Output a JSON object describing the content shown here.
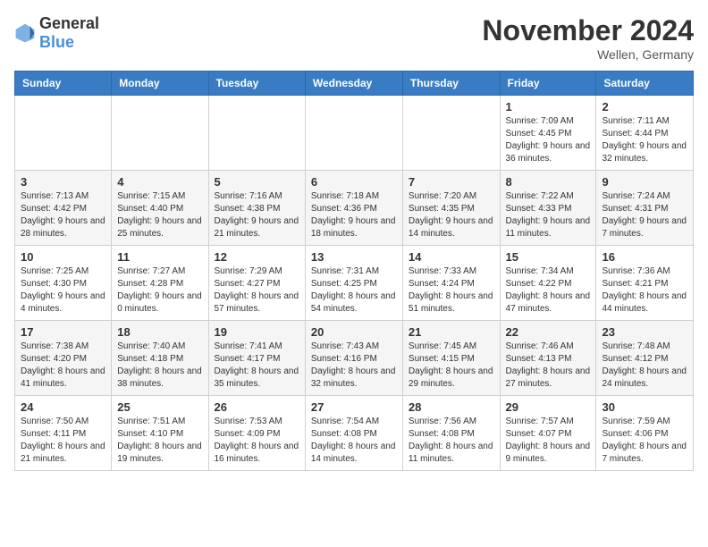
{
  "logo": {
    "general": "General",
    "blue": "Blue"
  },
  "title": "November 2024",
  "location": "Wellen, Germany",
  "weekdays": [
    "Sunday",
    "Monday",
    "Tuesday",
    "Wednesday",
    "Thursday",
    "Friday",
    "Saturday"
  ],
  "weeks": [
    [
      {
        "day": "",
        "sunrise": "",
        "sunset": "",
        "daylight": ""
      },
      {
        "day": "",
        "sunrise": "",
        "sunset": "",
        "daylight": ""
      },
      {
        "day": "",
        "sunrise": "",
        "sunset": "",
        "daylight": ""
      },
      {
        "day": "",
        "sunrise": "",
        "sunset": "",
        "daylight": ""
      },
      {
        "day": "",
        "sunrise": "",
        "sunset": "",
        "daylight": ""
      },
      {
        "day": "1",
        "sunrise": "Sunrise: 7:09 AM",
        "sunset": "Sunset: 4:45 PM",
        "daylight": "Daylight: 9 hours and 36 minutes."
      },
      {
        "day": "2",
        "sunrise": "Sunrise: 7:11 AM",
        "sunset": "Sunset: 4:44 PM",
        "daylight": "Daylight: 9 hours and 32 minutes."
      }
    ],
    [
      {
        "day": "3",
        "sunrise": "Sunrise: 7:13 AM",
        "sunset": "Sunset: 4:42 PM",
        "daylight": "Daylight: 9 hours and 28 minutes."
      },
      {
        "day": "4",
        "sunrise": "Sunrise: 7:15 AM",
        "sunset": "Sunset: 4:40 PM",
        "daylight": "Daylight: 9 hours and 25 minutes."
      },
      {
        "day": "5",
        "sunrise": "Sunrise: 7:16 AM",
        "sunset": "Sunset: 4:38 PM",
        "daylight": "Daylight: 9 hours and 21 minutes."
      },
      {
        "day": "6",
        "sunrise": "Sunrise: 7:18 AM",
        "sunset": "Sunset: 4:36 PM",
        "daylight": "Daylight: 9 hours and 18 minutes."
      },
      {
        "day": "7",
        "sunrise": "Sunrise: 7:20 AM",
        "sunset": "Sunset: 4:35 PM",
        "daylight": "Daylight: 9 hours and 14 minutes."
      },
      {
        "day": "8",
        "sunrise": "Sunrise: 7:22 AM",
        "sunset": "Sunset: 4:33 PM",
        "daylight": "Daylight: 9 hours and 11 minutes."
      },
      {
        "day": "9",
        "sunrise": "Sunrise: 7:24 AM",
        "sunset": "Sunset: 4:31 PM",
        "daylight": "Daylight: 9 hours and 7 minutes."
      }
    ],
    [
      {
        "day": "10",
        "sunrise": "Sunrise: 7:25 AM",
        "sunset": "Sunset: 4:30 PM",
        "daylight": "Daylight: 9 hours and 4 minutes."
      },
      {
        "day": "11",
        "sunrise": "Sunrise: 7:27 AM",
        "sunset": "Sunset: 4:28 PM",
        "daylight": "Daylight: 9 hours and 0 minutes."
      },
      {
        "day": "12",
        "sunrise": "Sunrise: 7:29 AM",
        "sunset": "Sunset: 4:27 PM",
        "daylight": "Daylight: 8 hours and 57 minutes."
      },
      {
        "day": "13",
        "sunrise": "Sunrise: 7:31 AM",
        "sunset": "Sunset: 4:25 PM",
        "daylight": "Daylight: 8 hours and 54 minutes."
      },
      {
        "day": "14",
        "sunrise": "Sunrise: 7:33 AM",
        "sunset": "Sunset: 4:24 PM",
        "daylight": "Daylight: 8 hours and 51 minutes."
      },
      {
        "day": "15",
        "sunrise": "Sunrise: 7:34 AM",
        "sunset": "Sunset: 4:22 PM",
        "daylight": "Daylight: 8 hours and 47 minutes."
      },
      {
        "day": "16",
        "sunrise": "Sunrise: 7:36 AM",
        "sunset": "Sunset: 4:21 PM",
        "daylight": "Daylight: 8 hours and 44 minutes."
      }
    ],
    [
      {
        "day": "17",
        "sunrise": "Sunrise: 7:38 AM",
        "sunset": "Sunset: 4:20 PM",
        "daylight": "Daylight: 8 hours and 41 minutes."
      },
      {
        "day": "18",
        "sunrise": "Sunrise: 7:40 AM",
        "sunset": "Sunset: 4:18 PM",
        "daylight": "Daylight: 8 hours and 38 minutes."
      },
      {
        "day": "19",
        "sunrise": "Sunrise: 7:41 AM",
        "sunset": "Sunset: 4:17 PM",
        "daylight": "Daylight: 8 hours and 35 minutes."
      },
      {
        "day": "20",
        "sunrise": "Sunrise: 7:43 AM",
        "sunset": "Sunset: 4:16 PM",
        "daylight": "Daylight: 8 hours and 32 minutes."
      },
      {
        "day": "21",
        "sunrise": "Sunrise: 7:45 AM",
        "sunset": "Sunset: 4:15 PM",
        "daylight": "Daylight: 8 hours and 29 minutes."
      },
      {
        "day": "22",
        "sunrise": "Sunrise: 7:46 AM",
        "sunset": "Sunset: 4:13 PM",
        "daylight": "Daylight: 8 hours and 27 minutes."
      },
      {
        "day": "23",
        "sunrise": "Sunrise: 7:48 AM",
        "sunset": "Sunset: 4:12 PM",
        "daylight": "Daylight: 8 hours and 24 minutes."
      }
    ],
    [
      {
        "day": "24",
        "sunrise": "Sunrise: 7:50 AM",
        "sunset": "Sunset: 4:11 PM",
        "daylight": "Daylight: 8 hours and 21 minutes."
      },
      {
        "day": "25",
        "sunrise": "Sunrise: 7:51 AM",
        "sunset": "Sunset: 4:10 PM",
        "daylight": "Daylight: 8 hours and 19 minutes."
      },
      {
        "day": "26",
        "sunrise": "Sunrise: 7:53 AM",
        "sunset": "Sunset: 4:09 PM",
        "daylight": "Daylight: 8 hours and 16 minutes."
      },
      {
        "day": "27",
        "sunrise": "Sunrise: 7:54 AM",
        "sunset": "Sunset: 4:08 PM",
        "daylight": "Daylight: 8 hours and 14 minutes."
      },
      {
        "day": "28",
        "sunrise": "Sunrise: 7:56 AM",
        "sunset": "Sunset: 4:08 PM",
        "daylight": "Daylight: 8 hours and 11 minutes."
      },
      {
        "day": "29",
        "sunrise": "Sunrise: 7:57 AM",
        "sunset": "Sunset: 4:07 PM",
        "daylight": "Daylight: 8 hours and 9 minutes."
      },
      {
        "day": "30",
        "sunrise": "Sunrise: 7:59 AM",
        "sunset": "Sunset: 4:06 PM",
        "daylight": "Daylight: 8 hours and 7 minutes."
      }
    ]
  ]
}
